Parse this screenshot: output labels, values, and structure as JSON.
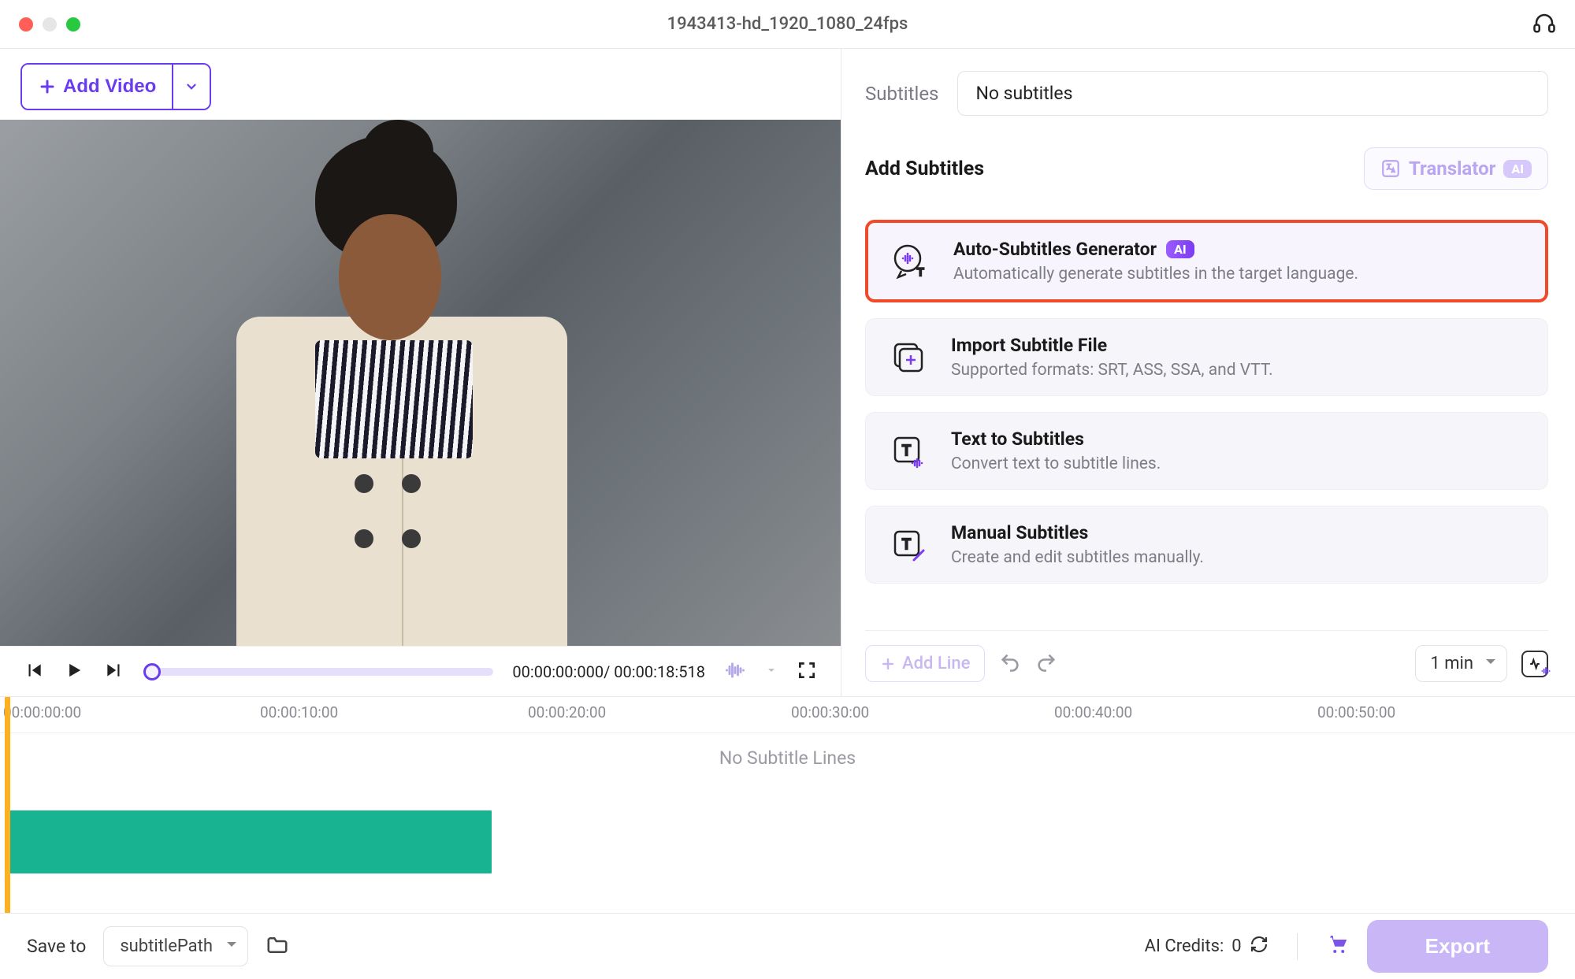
{
  "window": {
    "title": "1943413-hd_1920_1080_24fps"
  },
  "toolbar": {
    "add_video_label": "Add Video"
  },
  "player": {
    "time_label": "00:00:00:000/ 00:00:18:518"
  },
  "subtitles_panel": {
    "label": "Subtitles",
    "dropdown_value": "No subtitles",
    "add_section_title": "Add Subtitles",
    "translator_label": "Translator",
    "options": {
      "auto": {
        "title": "Auto-Subtitles Generator",
        "desc": "Automatically generate subtitles in the target language."
      },
      "import": {
        "title": "Import Subtitle File",
        "desc": "Supported formats: SRT, ASS, SSA, and VTT."
      },
      "text": {
        "title": "Text to Subtitles",
        "desc": "Convert text to subtitle lines."
      },
      "manual": {
        "title": "Manual Subtitles",
        "desc": "Create and edit subtitles manually."
      }
    },
    "add_line_label": "Add Line",
    "zoom_value": "1 min",
    "ai_badge": "AI"
  },
  "timeline": {
    "ticks": [
      "00:00:00:00",
      "00:00:10:00",
      "00:00:20:00",
      "00:00:30:00",
      "00:00:40:00",
      "00:00:50:00"
    ],
    "no_lines": "No Subtitle Lines"
  },
  "footer": {
    "save_to_label": "Save to",
    "path_value": "subtitlePath",
    "credits_label": "AI Credits:",
    "credits_value": "0",
    "export_label": "Export"
  }
}
